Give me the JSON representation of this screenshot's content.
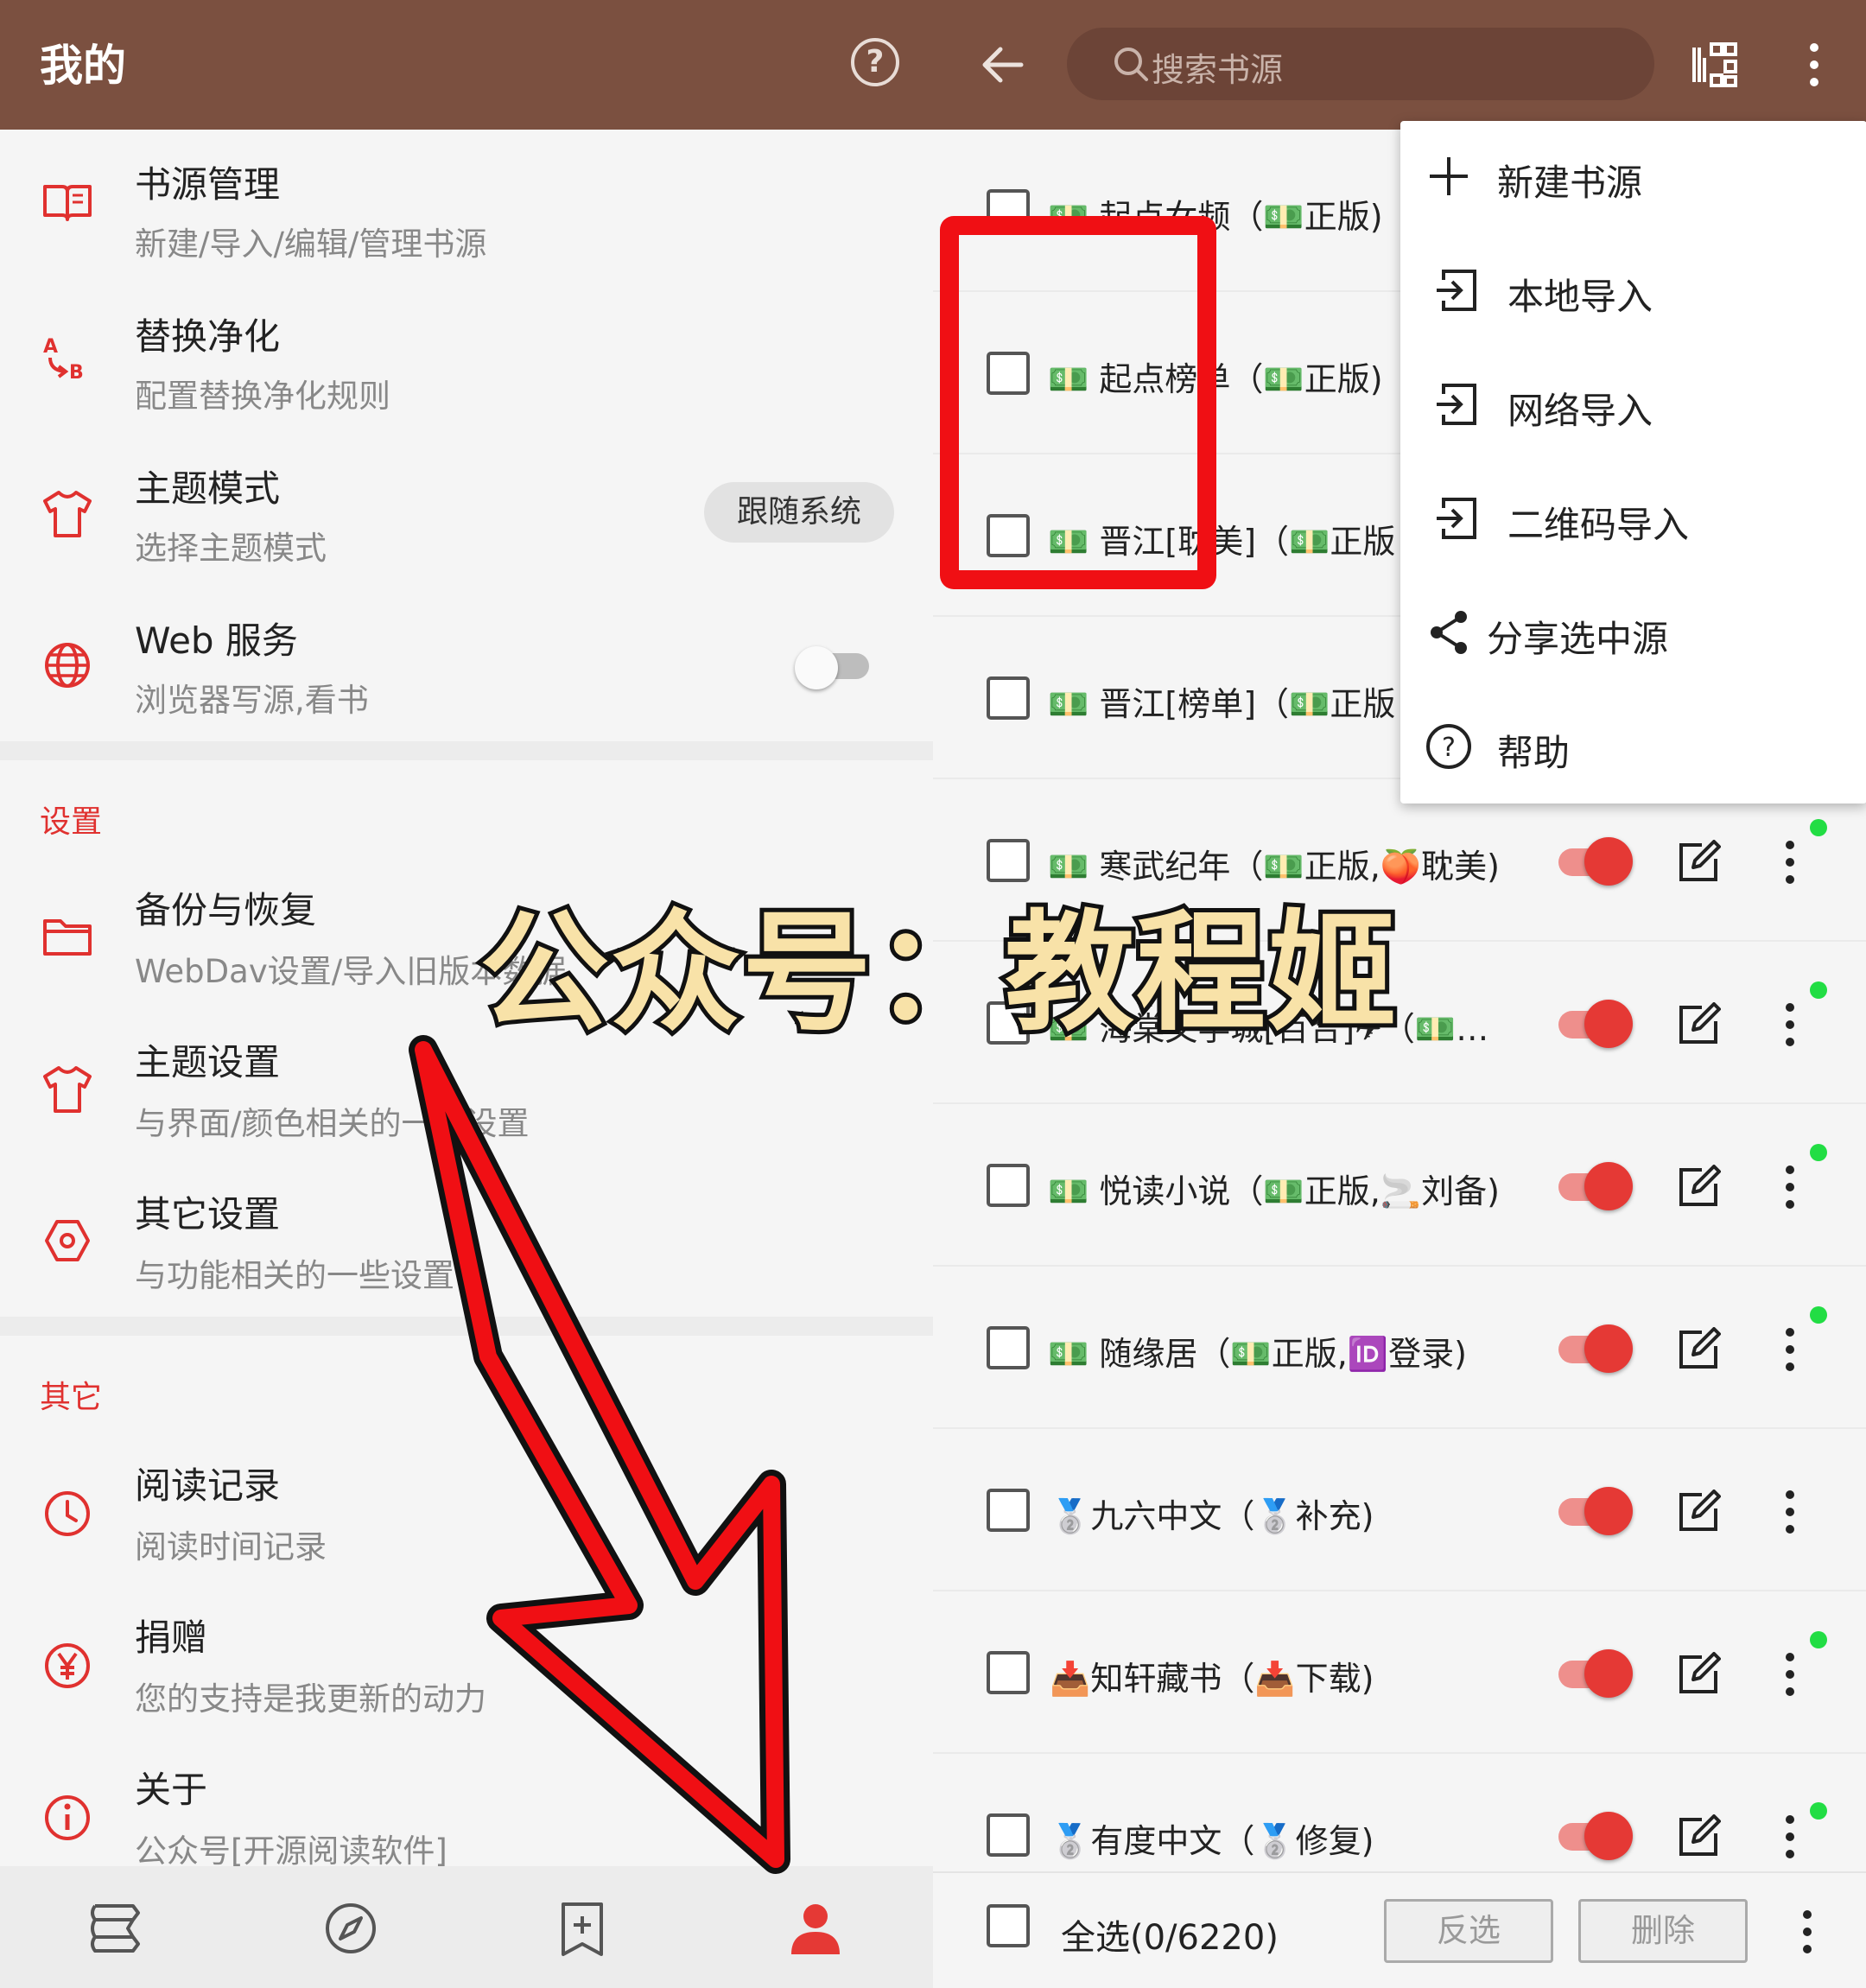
{
  "colors": {
    "appbar": "#7b5040",
    "accent": "#e0312f",
    "overlay_red": "#f00f14",
    "online_dot": "#22dd44"
  },
  "left": {
    "title": "我的",
    "help_icon": "question-circle-icon",
    "items": [
      {
        "icon": "book-icon",
        "title": "书源管理",
        "subtitle": "新建/导入/编辑/管理书源"
      },
      {
        "icon": "replace-ab-icon",
        "title": "替换净化",
        "subtitle": "配置替换净化规则"
      },
      {
        "icon": "tshirt-icon",
        "title": "主题模式",
        "subtitle": "选择主题模式",
        "chip": "跟随系统"
      },
      {
        "icon": "globe-icon",
        "title": "Web 服务",
        "subtitle": "浏览器写源,看书",
        "switch_on": false
      }
    ],
    "section_settings": "设置",
    "settings": [
      {
        "icon": "folder-icon",
        "title": "备份与恢复",
        "subtitle": "WebDav设置/导入旧版本数据"
      },
      {
        "icon": "tshirt-icon",
        "title": "主题设置",
        "subtitle": "与界面/颜色相关的一些设置"
      },
      {
        "icon": "settings-hexagon-icon",
        "title": "其它设置",
        "subtitle": "与功能相关的一些设置"
      }
    ],
    "section_other": "其它",
    "other": [
      {
        "icon": "clock-icon",
        "title": "阅读记录",
        "subtitle": "阅读时间记录"
      },
      {
        "icon": "yen-icon",
        "title": "捐赠",
        "subtitle": "您的支持是我更新的动力"
      },
      {
        "icon": "info-icon",
        "title": "关于",
        "subtitle": "公众号[开源阅读软件]"
      }
    ],
    "bottom_nav": [
      "bookshelf-icon",
      "explore-compass-icon",
      "rss-bookmark-icon",
      "profile-person-icon"
    ],
    "bottom_nav_active": 3
  },
  "right": {
    "search_placeholder": "搜索书源",
    "menu": [
      {
        "icon": "plus-icon",
        "label": "新建书源"
      },
      {
        "icon": "import-icon",
        "label": "本地导入"
      },
      {
        "icon": "import-icon",
        "label": "网络导入"
      },
      {
        "icon": "import-icon",
        "label": "二维码导入"
      },
      {
        "icon": "share-icon",
        "label": "分享选中源"
      },
      {
        "icon": "question-circle-icon",
        "label": "帮助"
      }
    ],
    "rows": [
      {
        "text": "💵 起点女频（💵正版)",
        "enabled": true,
        "online": false
      },
      {
        "text": "💵 起点榜单（💵正版)",
        "enabled": true,
        "online": false
      },
      {
        "text": "💵 晋江[耽美]（💵正版",
        "enabled": true,
        "online": false
      },
      {
        "text": "💵 晋江[榜单]（💵正版",
        "enabled": true,
        "online": false
      },
      {
        "text": "💵 寒武纪年（💵正版,🍑耽美)",
        "enabled": true,
        "online": true
      },
      {
        "text": "💵 海棠文学城[百合]✈（💵…",
        "enabled": true,
        "online": true
      },
      {
        "text": "💵 悦读小说（💵正版,🚬刘备)",
        "enabled": true,
        "online": true
      },
      {
        "text": "💵 随缘居（💵正版,🆔登录)",
        "enabled": true,
        "online": true
      },
      {
        "text": "🥈九六中文（🥈补充)",
        "enabled": true,
        "online": false
      },
      {
        "text": "📥知轩藏书（📥下载)",
        "enabled": true,
        "online": true
      },
      {
        "text": "🥈有度中文（🥈修复)",
        "enabled": true,
        "online": true
      }
    ],
    "select_all": "全选(0/6220)",
    "invert_label": "反选",
    "delete_label": "删除"
  },
  "overlay": {
    "watermark": "公众号：教程姬"
  }
}
